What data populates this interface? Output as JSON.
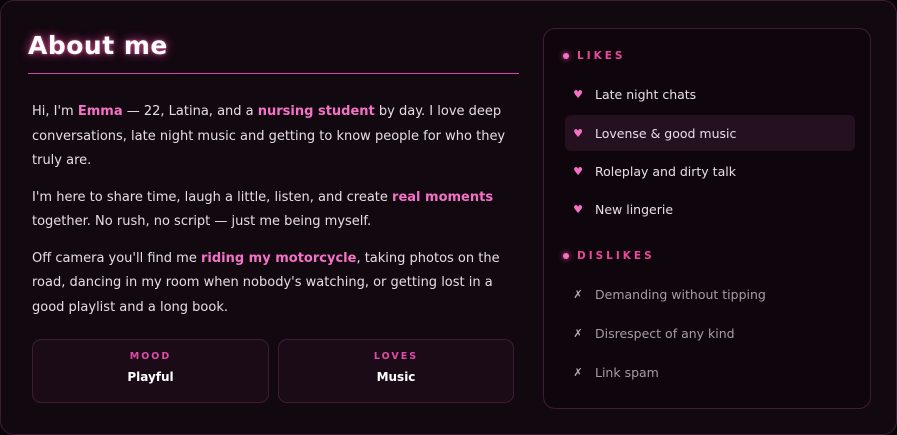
{
  "about": {
    "title": "About me",
    "p1": {
      "a": "Hi, I'm ",
      "name": "Emma",
      "b": " — 22, Latina, and a ",
      "role": "nursing student",
      "c": " by day. I love deep conversations, late night music and getting to know people for who they truly are."
    },
    "p2": {
      "a": "I'm here to share time, laugh a little, listen, and create ",
      "hl": "real moments",
      "b": " together. No rush, no script — just me being myself."
    },
    "p3": {
      "a": "Off camera you'll find me ",
      "hl": "riding my motorcycle",
      "b": ", taking photos on the road, dancing in my room when nobody's watching, or getting lost in a good playlist and a long book."
    },
    "stats": [
      {
        "label": "MOOD",
        "value": "Playful"
      },
      {
        "label": "LOVES",
        "value": "Music"
      }
    ]
  },
  "likes": {
    "heading": "LIKES",
    "icon": "heart-icon",
    "items": [
      {
        "label": "Late night chats"
      },
      {
        "label": "Lovense & good music"
      },
      {
        "label": "Roleplay and dirty talk"
      },
      {
        "label": "New lingerie"
      }
    ]
  },
  "dislikes": {
    "heading": "DISLIKES",
    "icon": "x-icon",
    "items": [
      {
        "label": "Demanding without tipping"
      },
      {
        "label": "Disrespect of any kind"
      },
      {
        "label": "Link spam"
      }
    ]
  },
  "colors": {
    "background": "#120810",
    "accent": "#ec4899",
    "highlight": "#f472c6",
    "text": "#e6dce4"
  }
}
